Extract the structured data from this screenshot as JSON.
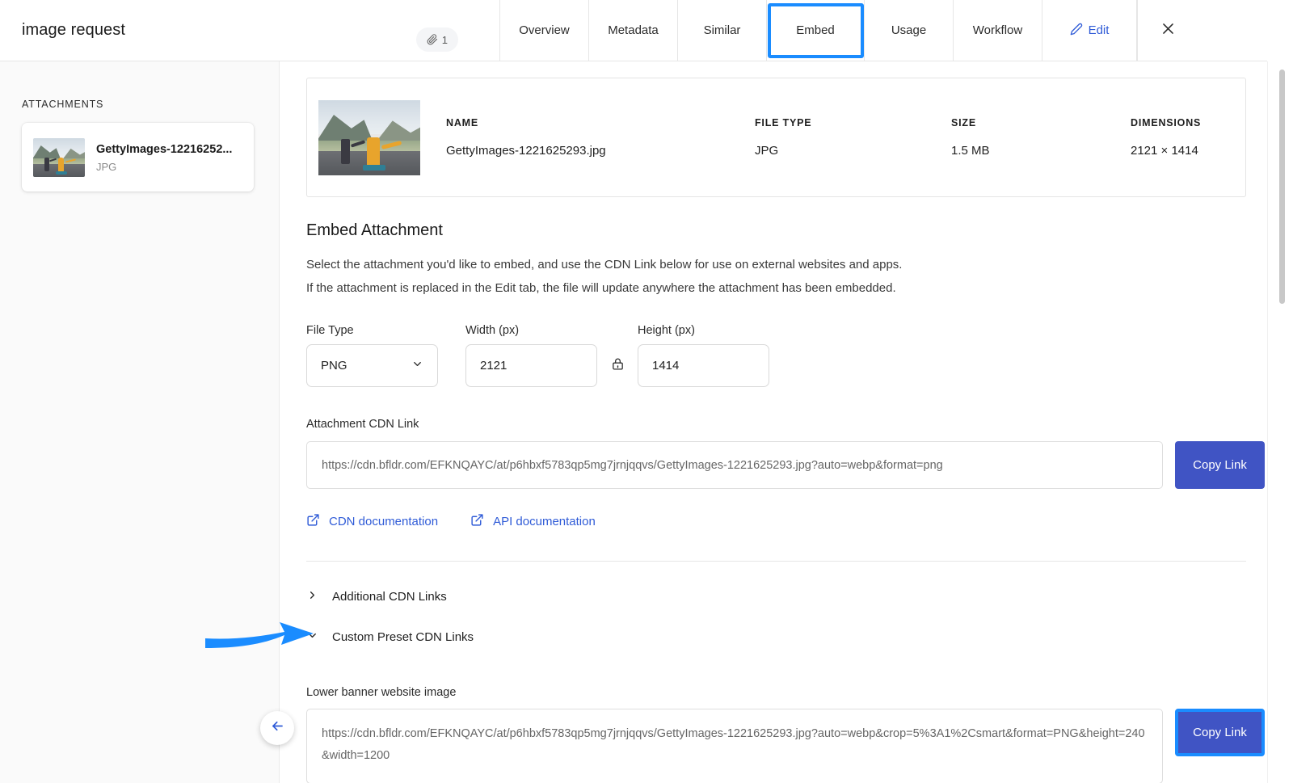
{
  "header": {
    "title": "image request",
    "attachment_count": "1",
    "attachment_icon": "paperclip-icon",
    "close_icon": "close-icon",
    "tabs": [
      {
        "label": "Overview",
        "active": false
      },
      {
        "label": "Metadata",
        "active": false
      },
      {
        "label": "Similar",
        "active": false
      },
      {
        "label": "Embed",
        "active": true
      },
      {
        "label": "Usage",
        "active": false
      },
      {
        "label": "Workflow",
        "active": false
      }
    ],
    "edit": {
      "label": "Edit",
      "icon": "pencil-icon"
    }
  },
  "sidebar": {
    "section_label": "ATTACHMENTS",
    "items": [
      {
        "name": "GettyImages-12216252...",
        "type": "JPG",
        "thumbnail": "skateboarders-photo"
      }
    ]
  },
  "file_info": {
    "thumbnail": "skateboarders-photo",
    "columns": [
      {
        "header": "NAME",
        "value": "GettyImages-1221625293.jpg"
      },
      {
        "header": "FILE TYPE",
        "value": "JPG"
      },
      {
        "header": "SIZE",
        "value": "1.5 MB"
      },
      {
        "header": "DIMENSIONS",
        "value": "2121 × 1414"
      }
    ]
  },
  "embed": {
    "section_title": "Embed Attachment",
    "description_line1": "Select the attachment you'd like to embed, and use the CDN Link below for use on external websites and apps.",
    "description_line2": "If the attachment is replaced in the Edit tab, the file will update anywhere the attachment has been embedded.",
    "file_type": {
      "label": "File Type",
      "value": "PNG",
      "icon": "chevron-down-icon"
    },
    "width": {
      "label": "Width (px)",
      "value": "2121"
    },
    "height": {
      "label": "Height (px)",
      "value": "1414"
    },
    "aspect_lock": {
      "icon": "lock-icon",
      "state": "locked"
    },
    "cdn_link": {
      "label": "Attachment CDN Link",
      "value": "https://cdn.bfldr.com/EFKNQAYC/at/p6hbxf5783qp5mg7jrnjqqvs/GettyImages-1221625293.jpg?auto=webp&format=png",
      "copy_label": "Copy Link"
    },
    "doc_links": [
      {
        "label": "CDN documentation",
        "icon": "external-link-icon"
      },
      {
        "label": "API documentation",
        "icon": "external-link-icon"
      }
    ],
    "collapsibles": [
      {
        "label": "Additional CDN Links",
        "expanded": false,
        "icon": "chevron-right-icon"
      },
      {
        "label": "Custom Preset CDN Links",
        "expanded": true,
        "icon": "chevron-down-icon"
      }
    ],
    "presets": [
      {
        "label": "Lower banner website image",
        "value": "https://cdn.bfldr.com/EFKNQAYC/at/p6hbxf5783qp5mg7jrnjqqvs/GettyImages-1221625293.jpg?auto=webp&crop=5%3A1%2Csmart&format=PNG&height=240&width=1200",
        "copy_label": "Copy Link"
      }
    ]
  },
  "back_button": {
    "icon": "arrow-left-icon"
  },
  "annotation": {
    "type": "pointer-arrow",
    "color": "#1a8cff",
    "points_to": "Custom Preset CDN Links"
  },
  "colors": {
    "accent_blue": "#2f5bd7",
    "focus_blue": "#1a8cff",
    "button_blue": "#4054c4",
    "panel_bg": "#fafafa",
    "border": "#e4e4e4"
  }
}
